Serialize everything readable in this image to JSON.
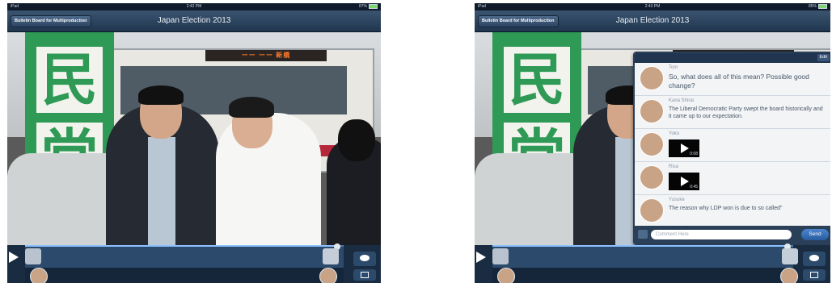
{
  "left": {
    "status": {
      "carrier": "iPad",
      "time": "2:42 PM",
      "battery": "87%"
    },
    "back_label": "Bulletin Board for Multiproduction",
    "title": "Japan Election 2013",
    "led_text": "ーー ーー 新橋",
    "progress_fraction": 0.98
  },
  "right": {
    "status": {
      "carrier": "iPad",
      "time": "2:43 PM",
      "battery": "85%"
    },
    "back_label": "Bulletin Board for Multiproduction",
    "title": "Japan Election 2013",
    "edit_label": "Edit",
    "messages": [
      {
        "name": "Tom",
        "text": "So, what does all of this mean? Possible good change?"
      },
      {
        "name": "Kana Shirai",
        "text": "The Liberal Democratic Party swept the board historically and it came up to our expectation."
      },
      {
        "name": "Yoko",
        "duration": "0:08"
      },
      {
        "name": "Risa",
        "duration": "0:45"
      },
      {
        "name": "Yusuke",
        "text": "The reason why LDP won is due to so called\""
      }
    ],
    "comment_placeholder": "Comment Here",
    "send_label": "Send",
    "progress_fraction": 0.98
  },
  "colors": {
    "navbar": "#20364f",
    "accent": "#4c86cf",
    "banner_green": "#2f9a55"
  },
  "icons": [
    "play-icon",
    "comment-icon",
    "edit-icon",
    "camera-icon",
    "video-play-icon"
  ]
}
